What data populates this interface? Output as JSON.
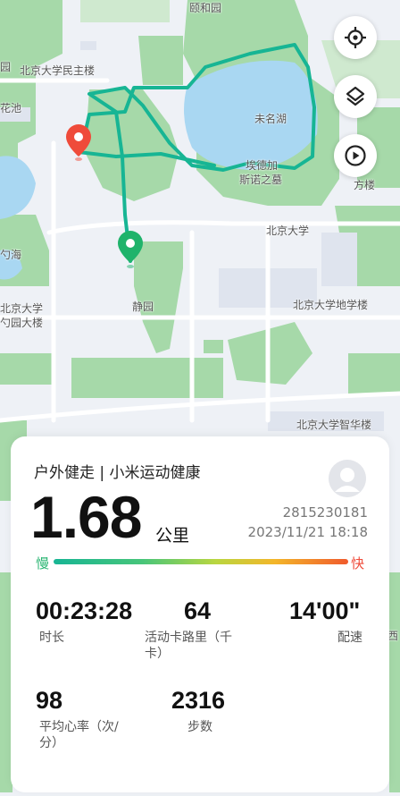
{
  "map": {
    "labels": {
      "top_partial": "颐和园",
      "minzhulou": "北京大学民主楼",
      "yuan": "园",
      "huachi": "花池",
      "weiminghu": "未名湖",
      "tomb_line1": "埃德加",
      "tomb_line2": "斯诺之墓",
      "fangta": "方楼",
      "pku": "北京大学",
      "shaoyuan_partial": "勺海",
      "pku_left_line1": "北京大学",
      "pku_left_line2": "勺园大楼",
      "jingyuan": "静园",
      "geo_building": "北京大学地学楼",
      "zhiyuan": "北京大学智华楼",
      "xi_partial": "西"
    },
    "controls": {
      "locate_icon": "locate-icon",
      "layers_icon": "layers-icon",
      "play_icon": "play-icon"
    },
    "markers": {
      "start_color": "#1fb36b",
      "end_color": "#ef4b3a"
    },
    "route_color": "#17b594"
  },
  "workout": {
    "title": "户外健走 | 小米运动健康",
    "distance": "1.68",
    "distance_unit": "公里",
    "user_id": "2815230181",
    "datetime": "2023/11/21 18:18",
    "pace_slow_label": "慢",
    "pace_fast_label": "快",
    "stats": [
      {
        "value": "00:23:28",
        "label": "时长"
      },
      {
        "value": "64",
        "label": "活动卡路里（千卡）"
      },
      {
        "value": "14'00\"",
        "label": "配速"
      },
      {
        "value": "98",
        "label": "平均心率（次/分）"
      },
      {
        "value": "2316",
        "label": "步数"
      }
    ]
  }
}
